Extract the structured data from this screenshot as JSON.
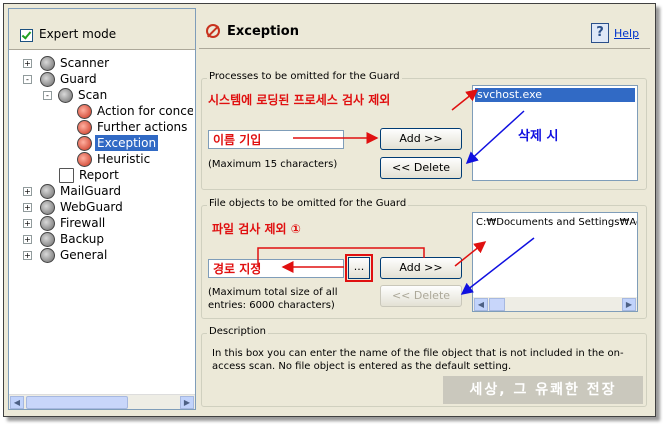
{
  "left": {
    "expert_mode": "Expert mode",
    "tree": [
      {
        "label": "Scanner",
        "expander": "+"
      },
      {
        "label": "Guard",
        "expander": "-"
      },
      {
        "label": "Scan",
        "expander": "-"
      },
      {
        "label": "Action for concern"
      },
      {
        "label": "Further actions"
      },
      {
        "label": "Exception"
      },
      {
        "label": "Heuristic"
      },
      {
        "label": "Report"
      },
      {
        "label": "MailGuard",
        "expander": "+"
      },
      {
        "label": "WebGuard",
        "expander": "+"
      },
      {
        "label": "Firewall",
        "expander": "+"
      },
      {
        "label": "Backup",
        "expander": "+"
      },
      {
        "label": "General",
        "expander": "+"
      }
    ]
  },
  "header": {
    "title": "Exception",
    "help": "Help",
    "help_icon": "?"
  },
  "processes": {
    "group_title": "Processes to be omitted for the Guard",
    "add_label": "Add >>",
    "delete_label": "<< Delete",
    "note": "(Maximum 15 characters)",
    "list_items": [
      "svchost.exe"
    ],
    "annotations": {
      "exclude": "시스템에 로딩된 프로세스 검사 제외",
      "enter_name": "이름 기입",
      "delete": "삭제 시"
    }
  },
  "files": {
    "group_title": "File objects to be omitted for the Guard",
    "add_label": "Add >>",
    "delete_label": "<< Delete",
    "browse_label": "...",
    "note_line1": "(Maximum total size of all",
    "note_line2": "entries: 6000 characters)",
    "list_items": [
      "C:₩Documents and Settings₩Ac"
    ],
    "annotations": {
      "exclude": "파일 검사 제외 ①",
      "path": "경로 지정"
    }
  },
  "description": {
    "group_title": "Description",
    "text": "In this box you can enter the name of the file object that is not included in the on-access scan. No file object is entered as the default setting."
  },
  "watermark": "세상, 그 유쾌한 전장",
  "colors": {
    "annotation_red": "#E01010",
    "annotation_blue": "#1010E0",
    "selection": "#316AC5"
  }
}
